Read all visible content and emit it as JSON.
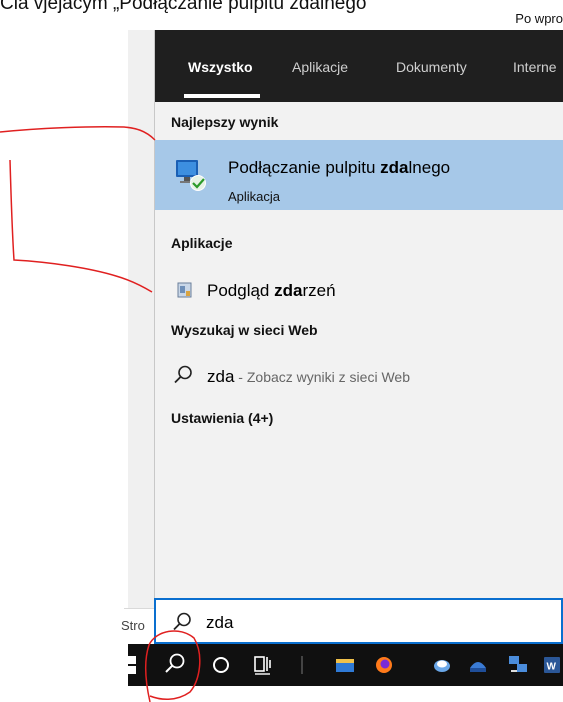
{
  "caption": {
    "main": "Cla vjejacym „Podłączanie pulpitu zdalnego",
    "right": "Po wpro"
  },
  "background_left": {
    "partial_text": "Stro"
  },
  "tabs": [
    {
      "label": "Wszystko",
      "active": true
    },
    {
      "label": "Aplikacje",
      "active": false
    },
    {
      "label": "Dokumenty",
      "active": false
    },
    {
      "label": "Interne",
      "active": false
    }
  ],
  "best_match": {
    "heading": "Najlepszy wynik",
    "title_prefix": "Podłączanie pulpitu ",
    "title_match": "zda",
    "title_suffix": "lnego",
    "subtitle": "Aplikacja",
    "icon": "remote-desktop-icon"
  },
  "apps": {
    "heading": "Aplikacje",
    "items": [
      {
        "prefix": "Podgląd ",
        "match": "zda",
        "suffix": "rzeń",
        "icon": "event-viewer-icon",
        "chevron": "›"
      }
    ]
  },
  "web": {
    "heading": "Wyszukaj w sieci Web",
    "items": [
      {
        "query": "zda",
        "hint": " - Zobacz wyniki z sieci Web",
        "icon": "search-icon",
        "chevron": "›"
      }
    ]
  },
  "settings": {
    "heading": "Ustawienia (4+)"
  },
  "searchbox": {
    "value": "zda",
    "icon": "search-icon"
  },
  "taskbar": {
    "items": [
      "start-icon",
      "search-icon",
      "cortana-icon",
      "task-view-icon",
      "file-explorer-icon",
      "firefox-icon",
      "app-icon",
      "app-icon",
      "remote-desktop-icon",
      "word-icon"
    ]
  },
  "colors": {
    "tabbar": "#1f1f1f",
    "panel": "#f2f2f2",
    "highlight": "#a6c8e8",
    "search_border": "#0a6fcf",
    "taskbar": "#101010",
    "annotation": "#e02020"
  }
}
